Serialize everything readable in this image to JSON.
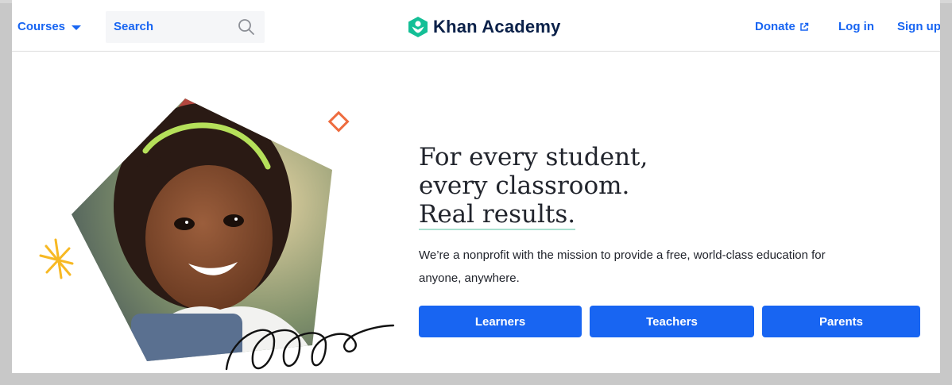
{
  "header": {
    "courses_label": "Courses",
    "search_placeholder": "Search",
    "logo_text": "Khan Academy",
    "donate_label": "Donate",
    "login_label": "Log in",
    "signup_label": "Sign up"
  },
  "hero": {
    "headline_line1": "For every student,",
    "headline_line2": "every classroom.",
    "headline_line3": "Real results.",
    "description": "We’re a nonprofit with the mission to provide a free, world-class education for anyone, anywhere.",
    "buttons": [
      "Learners",
      "Teachers",
      "Parents"
    ]
  },
  "colors": {
    "accent": "#1865f2",
    "logo_green": "#14bf96",
    "text": "#21242c",
    "navy": "#0b2149"
  },
  "icons": [
    "caret-down-icon",
    "search-icon",
    "khan-academy-logo-icon",
    "external-link-icon"
  ]
}
